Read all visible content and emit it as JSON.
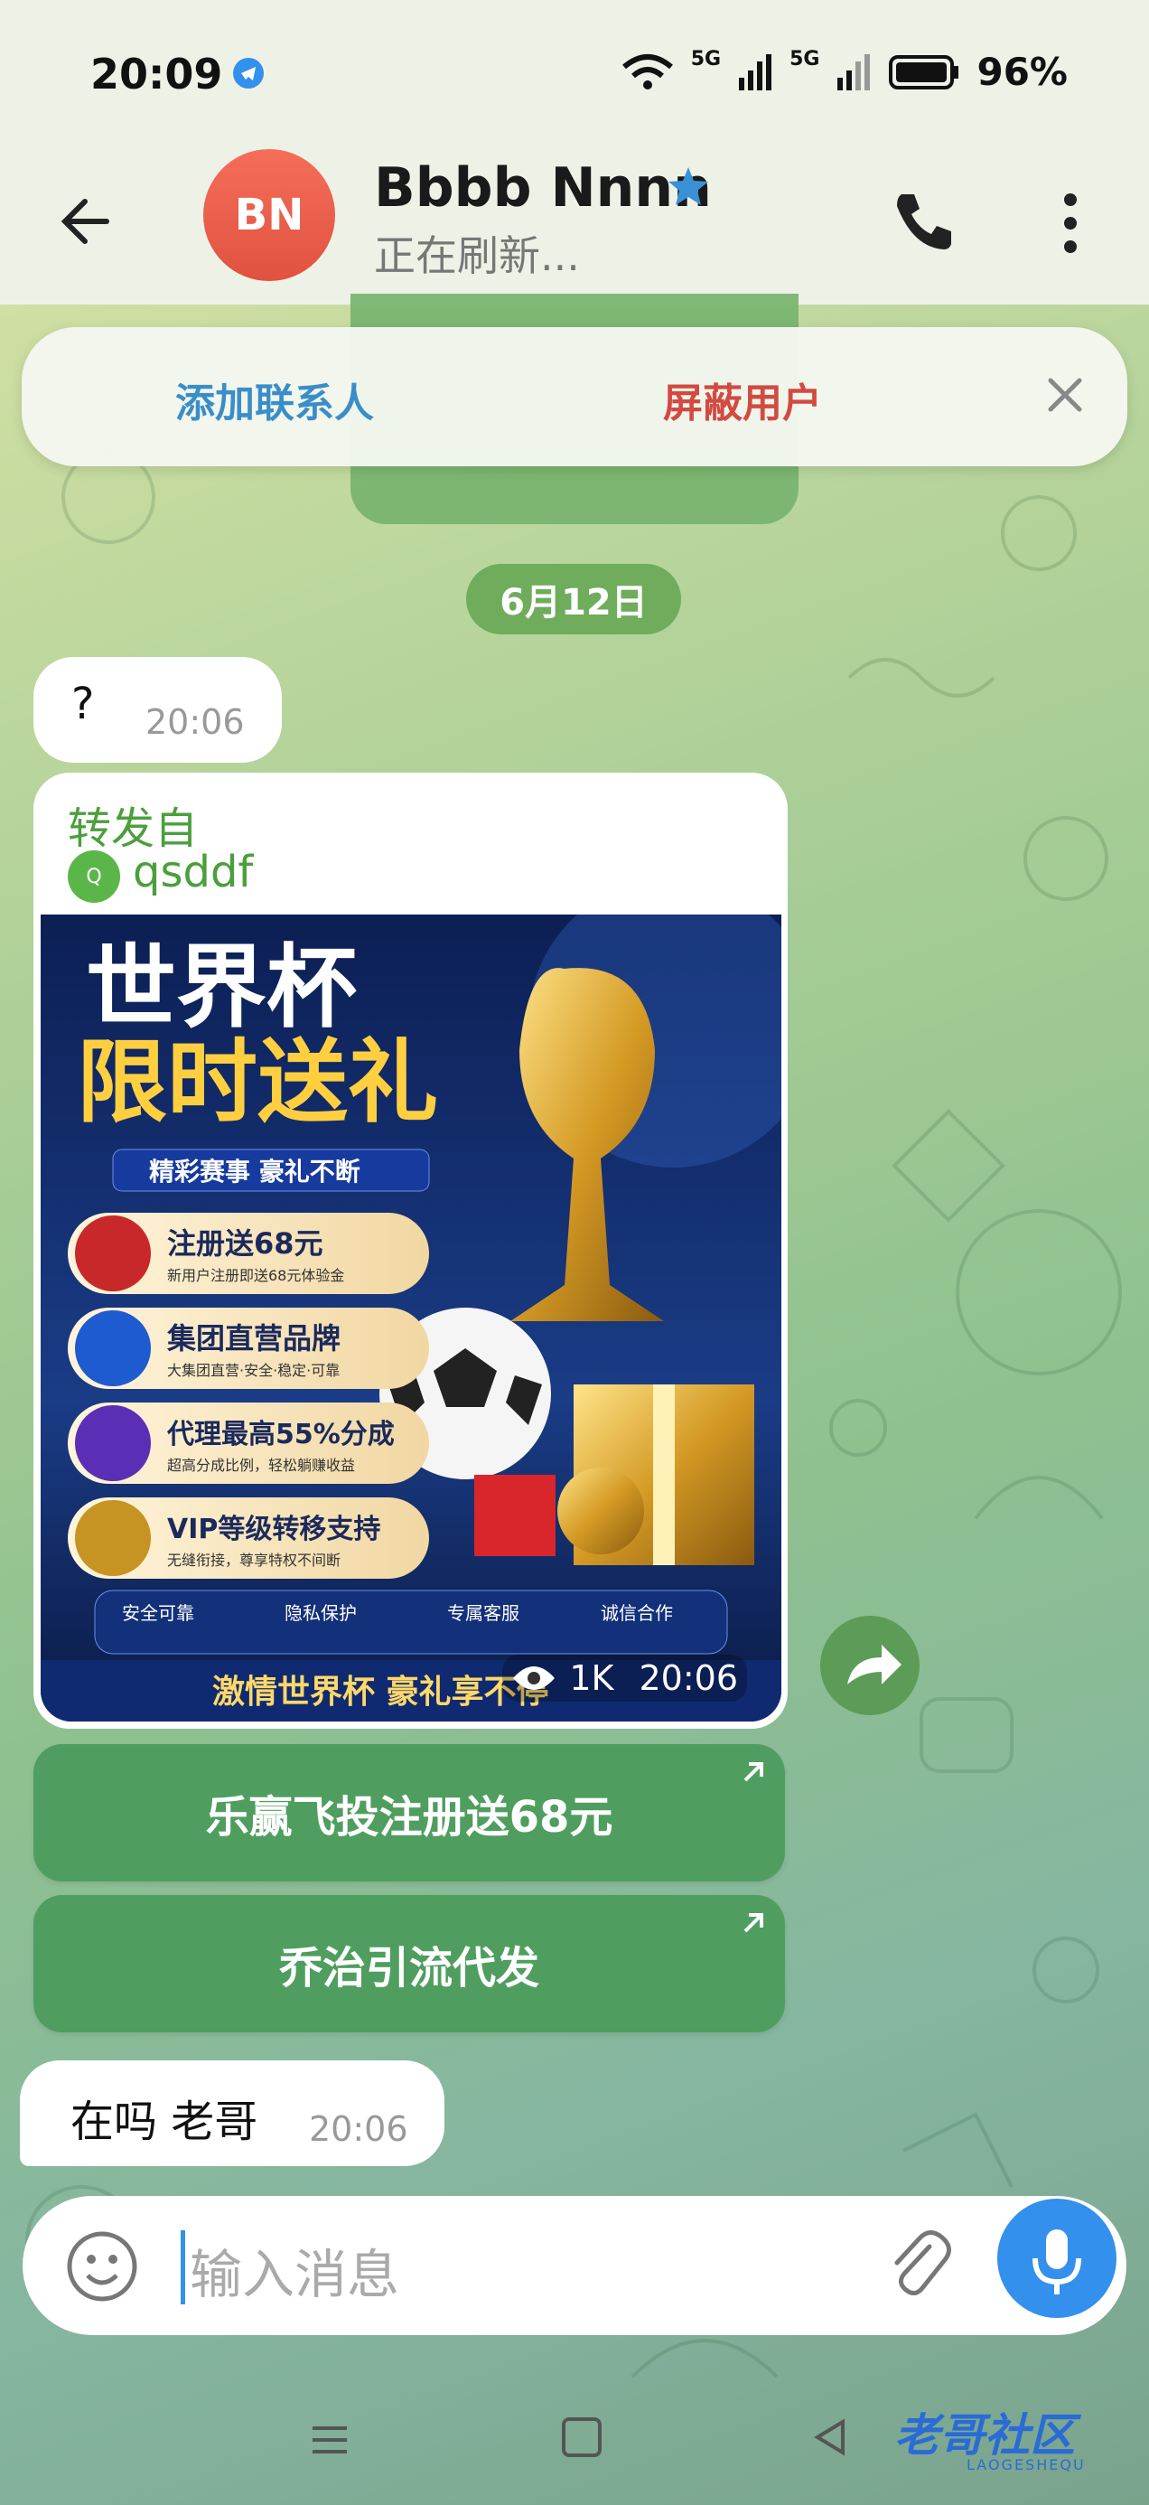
{
  "status_bar": {
    "time": "20:09",
    "battery": "96%"
  },
  "header": {
    "avatar_initials": "BN",
    "contact_name": "Bbbb Nnnn",
    "status": "正在刷新..."
  },
  "action_bar": {
    "add_contact": "添加联系人",
    "block_user": "屏蔽用户"
  },
  "messages": {
    "date": "6月12日",
    "items": [
      {
        "text": "?",
        "time": "20:06"
      },
      {
        "text": "在吗 老哥",
        "time": "20:06"
      }
    ],
    "forwarded": {
      "label": "转发自",
      "source_initial": "Q",
      "source": "qsddf",
      "views": "1K",
      "time": "20:06"
    }
  },
  "poster": {
    "title_line1": "世界杯",
    "title_line2": "限时送礼",
    "subtitle": "精彩赛事 豪礼不断",
    "features": [
      {
        "title": "注册送68元",
        "desc": "新用户注册即送68元体验金"
      },
      {
        "title": "集团直营品牌",
        "desc": "大集团直营·安全·稳定·可靠"
      },
      {
        "title": "代理最高55%分成",
        "desc": "超高分成比例，轻松躺赚收益"
      },
      {
        "title": "VIP等级转移支持",
        "desc": "无缝衔接，尊享特权不间断"
      }
    ],
    "badges": [
      "安全可靠",
      "隐私保护",
      "专属客服",
      "诚信合作"
    ],
    "footer": "激情世界杯 豪礼享不停"
  },
  "inline_buttons": [
    "乐赢飞投注册送68元",
    "乔治引流代发"
  ],
  "input": {
    "placeholder": "输入消息"
  },
  "watermark": {
    "text": "老哥社区",
    "sub": "LAOGESHEQU"
  },
  "colors": {
    "accent": "#3390ec",
    "button_green": "#4f9e5f",
    "block_red": "#d24a42",
    "add_blue": "#3a8ec8"
  }
}
